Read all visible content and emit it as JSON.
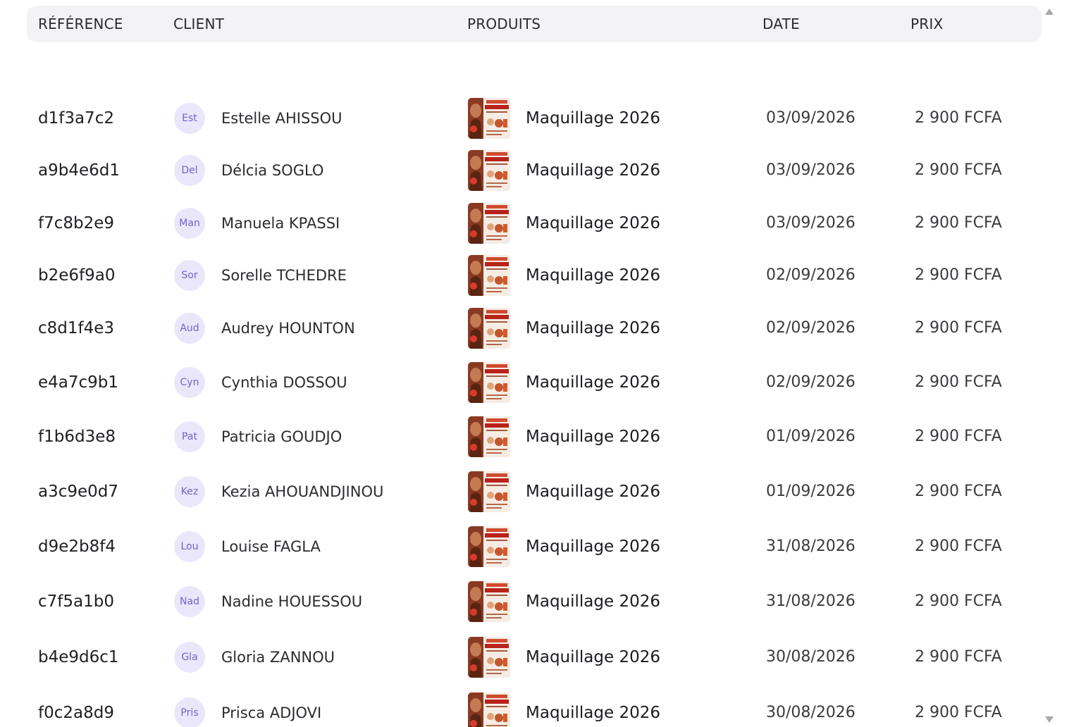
{
  "table": {
    "headers": {
      "reference": "RÉFÉRENCE",
      "client": "CLIENT",
      "produits": "PRODUITS",
      "date": "DATE",
      "prix": "PRIX"
    },
    "rows": [
      {
        "reference": "d1f3a7c2",
        "initials": "Est",
        "client": "Estelle AHISSOU",
        "product": "Maquillage 2026",
        "date": "03/09/2026",
        "price": "2 900 FCFA"
      },
      {
        "reference": "a9b4e6d1",
        "initials": "Del",
        "client": "Délcia SOGLO",
        "product": "Maquillage 2026",
        "date": "03/09/2026",
        "price": "2 900 FCFA"
      },
      {
        "reference": "f7c8b2e9",
        "initials": "Man",
        "client": "Manuela KPASSI",
        "product": "Maquillage 2026",
        "date": "03/09/2026",
        "price": "2 900 FCFA"
      },
      {
        "reference": "b2e6f9a0",
        "initials": "Sor",
        "client": "Sorelle TCHEDRE",
        "product": "Maquillage 2026",
        "date": "02/09/2026",
        "price": "2 900 FCFA"
      },
      {
        "reference": "c8d1f4e3",
        "initials": "Aud",
        "client": "Audrey HOUNTON",
        "product": "Maquillage 2026",
        "date": "02/09/2026",
        "price": "2 900 FCFA"
      },
      {
        "reference": "e4a7c9b1",
        "initials": "Cyn",
        "client": "Cynthia DOSSOU",
        "product": "Maquillage 2026",
        "date": "02/09/2026",
        "price": "2 900 FCFA"
      },
      {
        "reference": "f1b6d3e8",
        "initials": "Pat",
        "client": "Patricia GOUDJO",
        "product": "Maquillage 2026",
        "date": "01/09/2026",
        "price": "2 900 FCFA"
      },
      {
        "reference": "a3c9e0d7",
        "initials": "Kez",
        "client": "Kezia AHOUANDJINOU",
        "product": "Maquillage 2026",
        "date": "01/09/2026",
        "price": "2 900 FCFA"
      },
      {
        "reference": "d9e2b8f4",
        "initials": "Lou",
        "client": "Louise FAGLA",
        "product": "Maquillage 2026",
        "date": "31/08/2026",
        "price": "2 900 FCFA"
      },
      {
        "reference": "c7f5a1b0",
        "initials": "Nad",
        "client": "Nadine HOUESSOU",
        "product": "Maquillage 2026",
        "date": "31/08/2026",
        "price": "2 900 FCFA"
      },
      {
        "reference": "b4e9d6c1",
        "initials": "Gla",
        "client": "Gloria ZANNOU",
        "product": "Maquillage 2026",
        "date": "30/08/2026",
        "price": "2 900 FCFA"
      },
      {
        "reference": "f0c2a8d9",
        "initials": "Pris",
        "client": "Prisca ADJOVI",
        "product": "Maquillage 2026",
        "date": "30/08/2026",
        "price": "2 900 FCFA"
      }
    ]
  },
  "colors": {
    "header_bg": "#f3f3f5",
    "avatar_bg": "#ebe7fb",
    "avatar_text": "#7463c8"
  },
  "icons": {
    "product_thumbnail": "product-thumbnail",
    "scroll_up": "scroll-up-arrow-icon",
    "scroll_down": "scroll-down-arrow-icon"
  }
}
